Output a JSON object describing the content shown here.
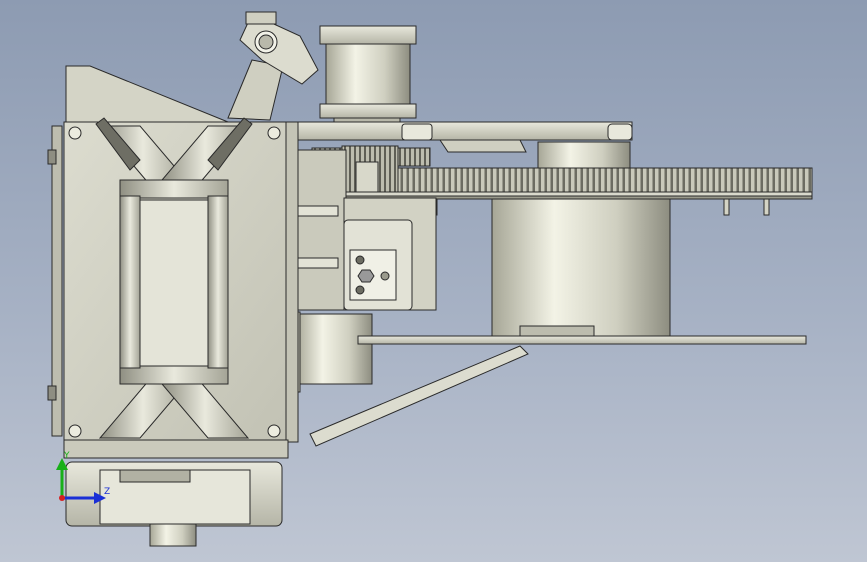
{
  "viewport": {
    "background_top": "#8d9bb2",
    "background_bottom": "#bfc6d3",
    "model_body_color": "#d4d4c6",
    "model_shadow_color": "#9c9c8e",
    "edge_color": "#2a2a2a"
  },
  "model": {
    "parts": [
      "gearbox-housing",
      "stepper-motor",
      "drive-pinion",
      "large-spur-gear",
      "turntable-cylinder",
      "lower-plate",
      "linkage-arm",
      "diagonal-strut",
      "base-bracket"
    ]
  },
  "triad": {
    "y_label": "Y",
    "z_label": "Z",
    "y_color": "#18b018",
    "z_color": "#1a2fd6"
  }
}
